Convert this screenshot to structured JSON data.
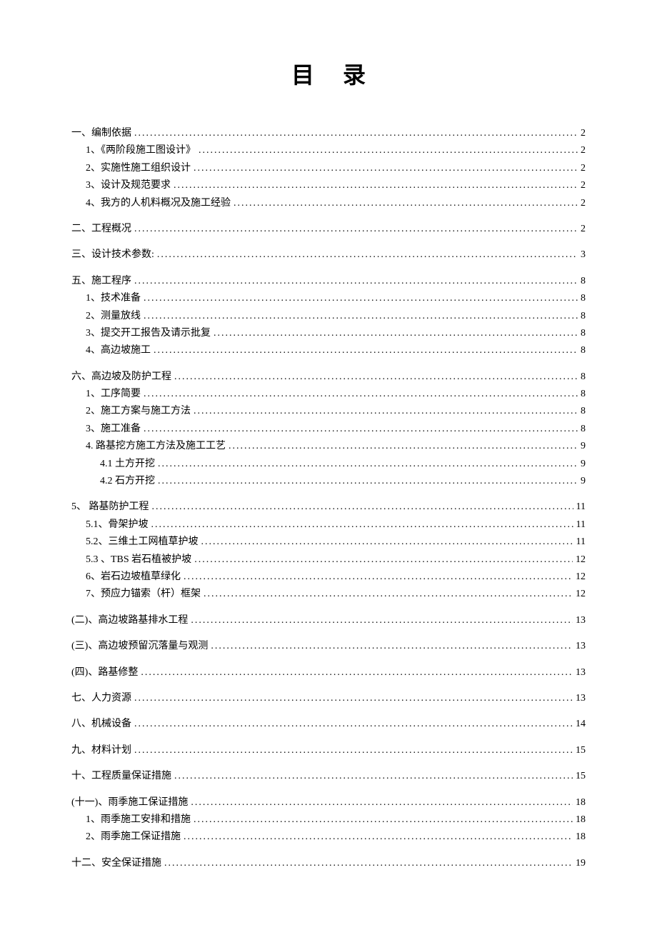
{
  "title": "目录",
  "entries": [
    {
      "level": 0,
      "label": "一、编制依据",
      "page": "2"
    },
    {
      "level": 1,
      "label": "1、《两阶段施工图设计》",
      "page": "2"
    },
    {
      "level": 1,
      "label": "2、实施性施工组织设计",
      "page": "2"
    },
    {
      "level": 1,
      "label": "3、设计及规范要求",
      "page": "2"
    },
    {
      "level": 1,
      "label": "4、我方的人机料概况及施工经验",
      "page": "2"
    },
    {
      "level": 0,
      "label": "二、工程概况",
      "page": "2"
    },
    {
      "level": 0,
      "label": "三、设计技术参数:",
      "page": "3"
    },
    {
      "level": 0,
      "label": "五、施工程序",
      "page": "8"
    },
    {
      "level": 1,
      "label": "1、技术准备",
      "page": "8"
    },
    {
      "level": 1,
      "label": "2、测量放线",
      "page": "8"
    },
    {
      "level": 1,
      "label": "3、提交开工报告及请示批复",
      "page": "8"
    },
    {
      "level": 1,
      "label": "4、高边坡施工",
      "page": "8"
    },
    {
      "level": 0,
      "label": "六、高边坡及防护工程",
      "page": "8"
    },
    {
      "level": 1,
      "label": "1、工序简要",
      "page": "8"
    },
    {
      "level": 1,
      "label": "2、施工方案与施工方法",
      "page": "8"
    },
    {
      "level": 1,
      "label": "3、施工准备",
      "page": "8"
    },
    {
      "level": 1,
      "label": "4. 路基挖方施工方法及施工工艺",
      "page": "9"
    },
    {
      "level": 2,
      "label": "4.1 土方开挖",
      "page": "9"
    },
    {
      "level": 2,
      "label": "4.2 石方开挖",
      "page": "9"
    },
    {
      "level": 0,
      "label": "5、 路基防护工程",
      "page": "11"
    },
    {
      "level": 1,
      "label": "5.1、骨架护坡",
      "page": "11"
    },
    {
      "level": 1,
      "label": "5.2、三维土工网植草护坡",
      "page": "11"
    },
    {
      "level": 1,
      "label": "5.3 、TBS 岩石植被护坡",
      "page": "12"
    },
    {
      "level": 1,
      "label": "6、岩石边坡植草绿化",
      "page": "12"
    },
    {
      "level": 1,
      "label": "7、预应力锚索（杆）框架",
      "page": "12"
    },
    {
      "level": 0,
      "label": "(二)、高边坡路基排水工程",
      "page": "13"
    },
    {
      "level": 0,
      "label": "(三)、高边坡预留沉落量与观测",
      "page": "13"
    },
    {
      "level": 0,
      "label": "(四)、路基修整",
      "page": "13"
    },
    {
      "level": 0,
      "label": "七、人力资源",
      "page": "13"
    },
    {
      "level": 0,
      "label": "八、机械设备",
      "page": "14"
    },
    {
      "level": 0,
      "label": "九、材料计划",
      "page": "15"
    },
    {
      "level": 0,
      "label": "十、工程质量保证措施",
      "page": "15"
    },
    {
      "level": 0,
      "label": "(十一)、雨季施工保证措施",
      "page": "18"
    },
    {
      "level": 1,
      "label": "1、雨季施工安排和措施",
      "page": "18"
    },
    {
      "level": 1,
      "label": "2、雨季施工保证措施",
      "page": "18"
    },
    {
      "level": 0,
      "label": "十二、安全保证措施",
      "page": "19"
    }
  ]
}
